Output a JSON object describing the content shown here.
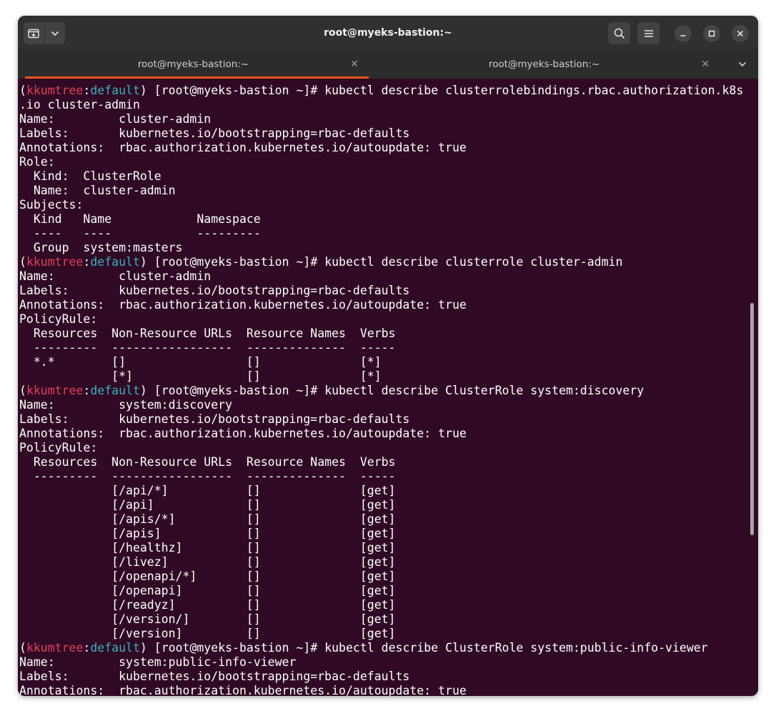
{
  "window": {
    "title": "root@myeks-bastion:~"
  },
  "titlebar": {
    "new_tab_icon": "new-tab-icon",
    "dropdown_icon": "chevron-down-icon",
    "search_icon": "search-icon",
    "menu_icon": "hamburger-menu-icon",
    "minimize_icon": "minimize-icon",
    "maximize_icon": "maximize-icon",
    "close_icon": "close-icon"
  },
  "tabs": [
    {
      "label": "root@myeks-bastion:~",
      "active": true
    },
    {
      "label": "root@myeks-bastion:~",
      "active": false
    }
  ],
  "colors": {
    "terminal_bg": "#300a24",
    "prompt_context": "#e0405a",
    "prompt_namespace": "#3ab0c0",
    "active_tab_accent": "#e95420"
  },
  "prompt": {
    "open": "(",
    "context": "kkumtree",
    "sep": ":",
    "namespace": "default",
    "rest": ") [root@myeks-bastion ~]# "
  },
  "terminal": {
    "lines": [
      {
        "type": "prompt",
        "command": "kubectl describe clusterrolebindings.rbac.authorization.k8s"
      },
      {
        "type": "text",
        "text": ".io cluster-admin"
      },
      {
        "type": "text",
        "text": "Name:         cluster-admin"
      },
      {
        "type": "text",
        "text": "Labels:       kubernetes.io/bootstrapping=rbac-defaults"
      },
      {
        "type": "text",
        "text": "Annotations:  rbac.authorization.kubernetes.io/autoupdate: true"
      },
      {
        "type": "text",
        "text": "Role:"
      },
      {
        "type": "text",
        "text": "  Kind:  ClusterRole"
      },
      {
        "type": "text",
        "text": "  Name:  cluster-admin"
      },
      {
        "type": "text",
        "text": "Subjects:"
      },
      {
        "type": "text",
        "text": "  Kind   Name            Namespace"
      },
      {
        "type": "text",
        "text": "  ----   ----            ---------"
      },
      {
        "type": "text",
        "text": "  Group  system:masters"
      },
      {
        "type": "prompt",
        "command": "kubectl describe clusterrole cluster-admin"
      },
      {
        "type": "text",
        "text": "Name:         cluster-admin"
      },
      {
        "type": "text",
        "text": "Labels:       kubernetes.io/bootstrapping=rbac-defaults"
      },
      {
        "type": "text",
        "text": "Annotations:  rbac.authorization.kubernetes.io/autoupdate: true"
      },
      {
        "type": "text",
        "text": "PolicyRule:"
      },
      {
        "type": "text",
        "text": "  Resources  Non-Resource URLs  Resource Names  Verbs"
      },
      {
        "type": "text",
        "text": "  ---------  -----------------  --------------  -----"
      },
      {
        "type": "text",
        "text": "  *.*        []                 []              [*]"
      },
      {
        "type": "text",
        "text": "             [*]                []              [*]"
      },
      {
        "type": "prompt",
        "command": "kubectl describe ClusterRole system:discovery"
      },
      {
        "type": "text",
        "text": "Name:         system:discovery"
      },
      {
        "type": "text",
        "text": "Labels:       kubernetes.io/bootstrapping=rbac-defaults"
      },
      {
        "type": "text",
        "text": "Annotations:  rbac.authorization.kubernetes.io/autoupdate: true"
      },
      {
        "type": "text",
        "text": "PolicyRule:"
      },
      {
        "type": "text",
        "text": "  Resources  Non-Resource URLs  Resource Names  Verbs"
      },
      {
        "type": "text",
        "text": "  ---------  -----------------  --------------  -----"
      },
      {
        "type": "text",
        "text": "             [/api/*]           []              [get]"
      },
      {
        "type": "text",
        "text": "             [/api]             []              [get]"
      },
      {
        "type": "text",
        "text": "             [/apis/*]          []              [get]"
      },
      {
        "type": "text",
        "text": "             [/apis]            []              [get]"
      },
      {
        "type": "text",
        "text": "             [/healthz]         []              [get]"
      },
      {
        "type": "text",
        "text": "             [/livez]           []              [get]"
      },
      {
        "type": "text",
        "text": "             [/openapi/*]       []              [get]"
      },
      {
        "type": "text",
        "text": "             [/openapi]         []              [get]"
      },
      {
        "type": "text",
        "text": "             [/readyz]          []              [get]"
      },
      {
        "type": "text",
        "text": "             [/version/]        []              [get]"
      },
      {
        "type": "text",
        "text": "             [/version]         []              [get]"
      },
      {
        "type": "prompt",
        "command": "kubectl describe ClusterRole system:public-info-viewer"
      },
      {
        "type": "text",
        "text": "Name:         system:public-info-viewer"
      },
      {
        "type": "text",
        "text": "Labels:       kubernetes.io/bootstrapping=rbac-defaults"
      },
      {
        "type": "text",
        "text": "Annotations:  rbac.authorization.kubernetes.io/autoupdate: true"
      }
    ]
  }
}
